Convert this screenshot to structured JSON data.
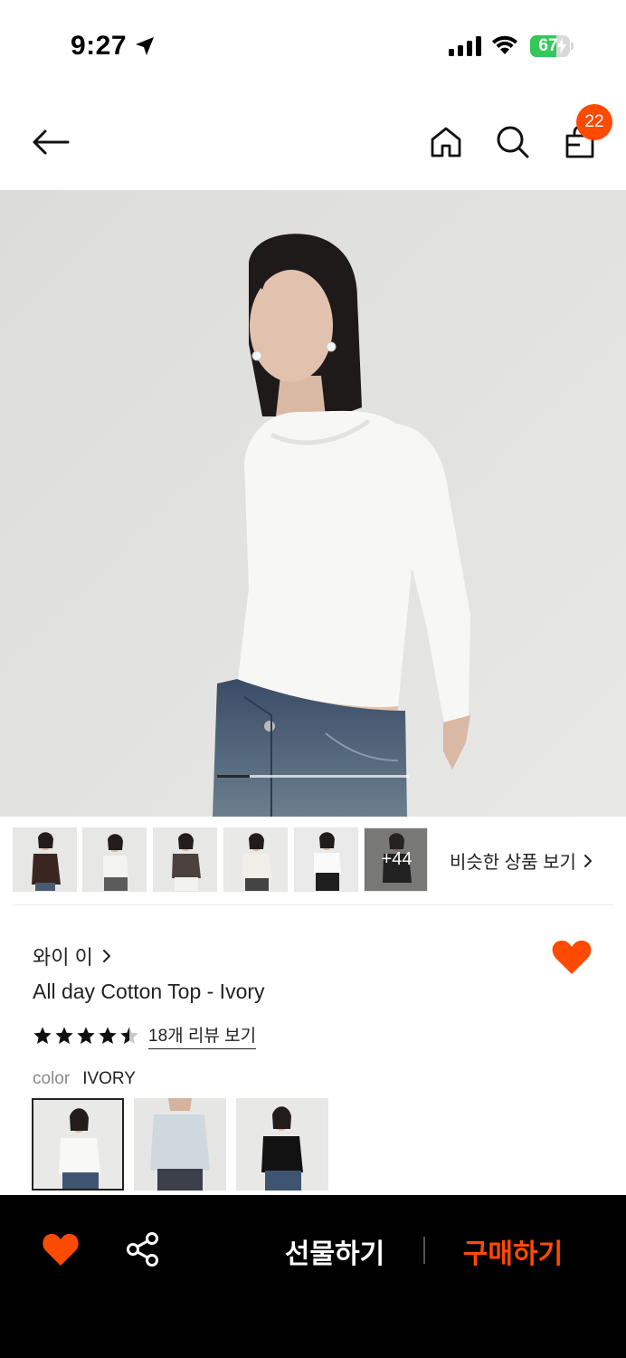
{
  "status_bar": {
    "time": "9:27",
    "battery_level": "67"
  },
  "header": {
    "cart_count": "22",
    "icons": [
      "back-arrow-icon",
      "home-icon",
      "search-icon",
      "shopping-bag-icon"
    ]
  },
  "gallery": {
    "current_image": 1,
    "total_images": 6,
    "more_count": "+44",
    "similar_label": "비슷한 상품 보기"
  },
  "product": {
    "brand": "와이 이",
    "name": "All day Cotton Top - Ivory",
    "rating": 4.5,
    "review_link": "18개 리뷰 보기",
    "color_label": "color",
    "color_value": "IVORY",
    "swatches": [
      "ivory",
      "light-blue",
      "black"
    ]
  },
  "bottom_bar": {
    "gift_label": "선물하기",
    "buy_label": "구매하기"
  },
  "colors": {
    "accent": "#ff4a00",
    "battery": "#34c759",
    "bar": "#000000"
  }
}
